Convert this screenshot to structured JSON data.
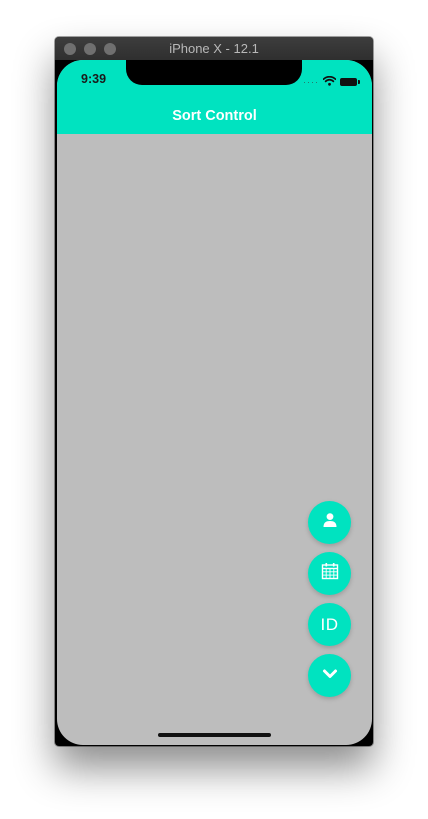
{
  "window": {
    "title": "iPhone X - 12.1"
  },
  "status_bar": {
    "time": "9:39",
    "icons": [
      "signal-dots-icon",
      "wifi-icon",
      "battery-icon"
    ]
  },
  "header": {
    "title": "Sort Control"
  },
  "fab_menu": {
    "buttons": [
      {
        "name": "sort-by-user",
        "icon": "person-icon"
      },
      {
        "name": "sort-by-date",
        "icon": "calendar-icon"
      },
      {
        "name": "sort-by-id",
        "icon": "id-text",
        "label": "ID"
      },
      {
        "name": "toggle-menu",
        "icon": "chevron-down-icon"
      }
    ]
  },
  "colors": {
    "accent": "#00e3c0",
    "background": "#bdbdbd",
    "on_accent": "#ffffff"
  }
}
